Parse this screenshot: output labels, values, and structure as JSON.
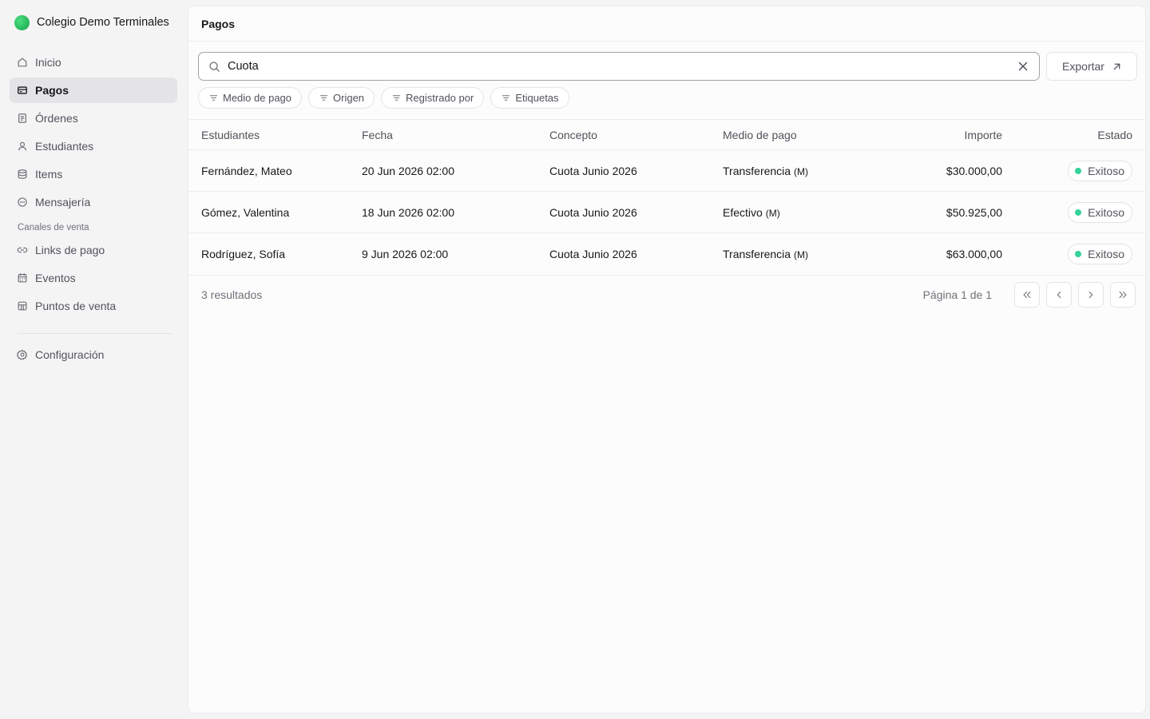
{
  "org": {
    "name": "Colegio Demo Terminales",
    "logo_color": "#22c55e"
  },
  "sidebar": {
    "items": [
      {
        "label": "Inicio",
        "icon": "home-icon",
        "active": false
      },
      {
        "label": "Pagos",
        "icon": "credit-card-icon",
        "active": true
      },
      {
        "label": "Órdenes",
        "icon": "receipt-icon",
        "active": false
      },
      {
        "label": "Estudiantes",
        "icon": "user-icon",
        "active": false
      },
      {
        "label": "Items",
        "icon": "layers-icon",
        "active": false
      },
      {
        "label": "Mensajería",
        "icon": "message-icon",
        "active": false
      }
    ],
    "section_label": "Canales de venta",
    "channels": [
      {
        "label": "Links de pago",
        "icon": "link-icon"
      },
      {
        "label": "Eventos",
        "icon": "calendar-icon"
      },
      {
        "label": "Puntos de venta",
        "icon": "store-icon"
      }
    ],
    "settings": {
      "label": "Configuración",
      "icon": "gear-icon"
    }
  },
  "header": {
    "title": "Pagos"
  },
  "search": {
    "value": "Cuota",
    "placeholder": ""
  },
  "export_label": "Exportar",
  "filters": [
    "Medio de pago",
    "Origen",
    "Registrado por",
    "Etiquetas"
  ],
  "table": {
    "columns": [
      "Estudiantes",
      "Fecha",
      "Concepto",
      "Medio de pago",
      "Importe",
      "Estado"
    ],
    "rows": [
      {
        "student": "Fernández, Mateo",
        "date": "20 Jun 2026 02:00",
        "concept": "Cuota Junio 2026",
        "method": "Transferencia",
        "method_suffix": "(M)",
        "amount": "$30.000,00",
        "status": "Exitoso"
      },
      {
        "student": "Gómez, Valentina",
        "date": "18 Jun 2026 02:00",
        "concept": "Cuota Junio 2026",
        "method": "Efectivo",
        "method_suffix": "(M)",
        "amount": "$50.925,00",
        "status": "Exitoso"
      },
      {
        "student": "Rodríguez, Sofía",
        "date": "9 Jun 2026 02:00",
        "concept": "Cuota Junio 2026",
        "method": "Transferencia",
        "method_suffix": "(M)",
        "amount": "$63.000,00",
        "status": "Exitoso"
      }
    ]
  },
  "footer": {
    "results": "3 resultados",
    "page_info": "Página 1 de 1"
  },
  "colors": {
    "status_success": "#34d399",
    "active_nav_bg": "#e4e4e7"
  }
}
